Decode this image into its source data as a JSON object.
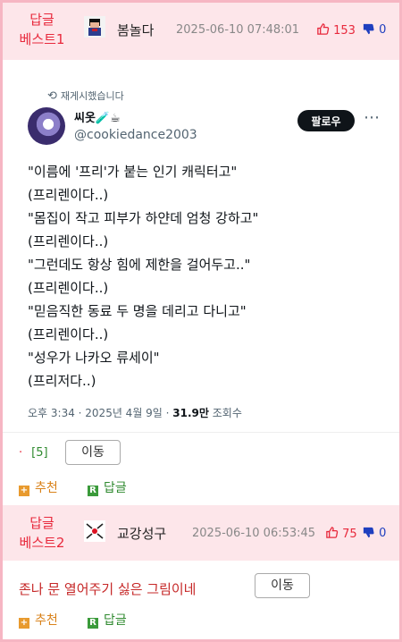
{
  "comments": [
    {
      "best_line1": "답글",
      "best_line2": "베스트1",
      "nick": "봄놀다",
      "date": "2025-06-10 07:48:01",
      "up_icon": "thumbs-up-icon",
      "down_icon": "thumbs-down-icon",
      "up": "153",
      "down": "0"
    },
    {
      "best_line1": "답글",
      "best_line2": "베스트2",
      "nick": "교강성구",
      "date": "2025-06-10 06:53:45",
      "up": "75",
      "down": "0",
      "text": "존나 문 열어주기 싫은 그림이네"
    }
  ],
  "tweet": {
    "retweet_label": "재게시했습니다",
    "name": "씨옷🧪☕",
    "handle": "@cookiedance2003",
    "follow_label": "팔로우",
    "lines": [
      "\"이름에 '프리'가 붙는 인기 캐릭터고\"",
      "(프리렌이다..)",
      "\"몸집이 작고 피부가 하얀데 엄청 강하고\"",
      "(프리렌이다..)",
      "\"그런데도 항상 힘에 제한을 걸어두고..\"",
      "(프리렌이다..)",
      "\"믿음직한 동료 두 명을 데리고 다니고\"",
      "(프리렌이다..)",
      "\"성우가 나카오 류세이\"",
      "(프리저다..)"
    ],
    "time": "오후 3:34 · 2025년 4월 9일 · ",
    "views": "31.9만",
    "views_label": " 조회수"
  },
  "reply_count": "[5]",
  "move_label": "이동",
  "recommend_label": "추천",
  "reply_label": "답글",
  "colors": {
    "accent": "#e8293c",
    "bar": "#fde6ea",
    "border": "#f6b6c3"
  }
}
